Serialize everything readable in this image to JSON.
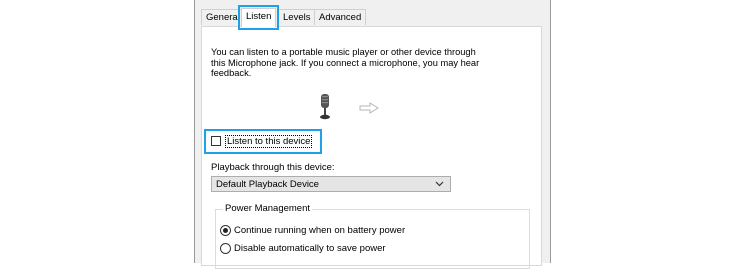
{
  "tabs": [
    {
      "label": "General",
      "active": false
    },
    {
      "label": "Listen",
      "active": true
    },
    {
      "label": "Levels",
      "active": false
    },
    {
      "label": "Advanced",
      "active": false
    }
  ],
  "description": "You can listen to a portable music player or other device through\nthis Microphone jack.  If you connect a microphone, you may hear\nfeedback.",
  "icons": {
    "device": "microphone-icon",
    "direction": "right-arrow-icon"
  },
  "listen_checkbox": {
    "label": "Listen to this device",
    "checked": false
  },
  "playback": {
    "label": "Playback through this device:",
    "selected": "Default Playback Device"
  },
  "power": {
    "title": "Power Management",
    "options": [
      {
        "label": "Continue running when on battery power",
        "selected": true
      },
      {
        "label": "Disable automatically to save power",
        "selected": false
      }
    ]
  },
  "colors": {
    "highlight": "#1ea1e6",
    "dialog_bg": "#f0f0f0"
  }
}
